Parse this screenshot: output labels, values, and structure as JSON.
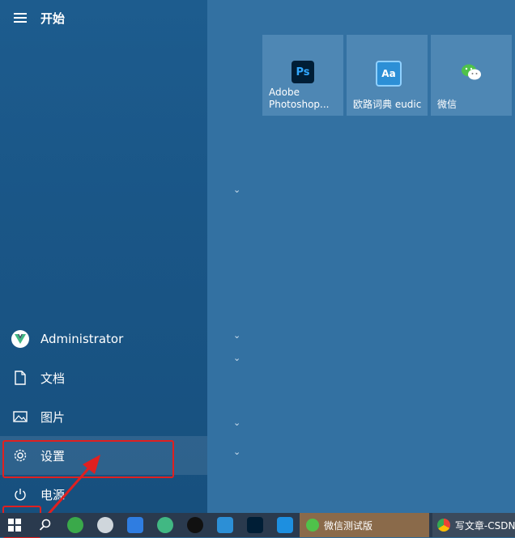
{
  "start": {
    "title": "开始",
    "user": "Administrator",
    "documents": "文档",
    "pictures": "图片",
    "settings": "设置",
    "power": "电源"
  },
  "tiles": [
    {
      "label": "Adobe Photoshop...",
      "icon": "Ps"
    },
    {
      "label": "欧路词典 eudic",
      "icon": "Aa"
    },
    {
      "label": "微信",
      "icon": "wechat"
    }
  ],
  "taskbar": {
    "apps": [
      {
        "label": "微信测试版"
      },
      {
        "label": "写文章-CSDN"
      }
    ]
  },
  "colors": {
    "accent_red": "#e02020",
    "photoshop": "#001e36",
    "eudic": "#2c8fd6",
    "wechat": "#4fc24a"
  }
}
